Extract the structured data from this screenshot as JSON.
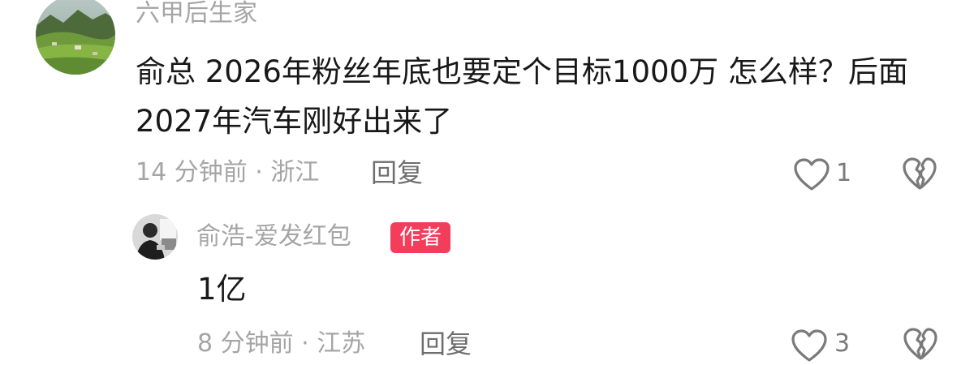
{
  "comment": {
    "author": "六甲后生家",
    "avatar_icon": "landscape-avatar",
    "text": "俞总 2026年粉丝年底也要定个目标1000万 怎么样？后面2027年汽车刚好出来了",
    "time_location": "14 分钟前 · 浙江",
    "reply_label": "回复",
    "like_icon": "heart-outline-icon",
    "like_count": "1",
    "dislike_icon": "broken-heart-icon"
  },
  "reply": {
    "author": "俞浩-爱发红包",
    "avatar_icon": "person-avatar",
    "badge": "作者",
    "text": "1亿",
    "time_location": "8 分钟前 · 江苏",
    "reply_label": "回复",
    "like_icon": "heart-outline-icon",
    "like_count": "3",
    "dislike_icon": "broken-heart-icon"
  },
  "colors": {
    "secondary_text": "#a5a5a5",
    "primary_text": "#181818",
    "badge_bg": "#f23d5b",
    "icon_stroke": "#7a7a7a"
  }
}
